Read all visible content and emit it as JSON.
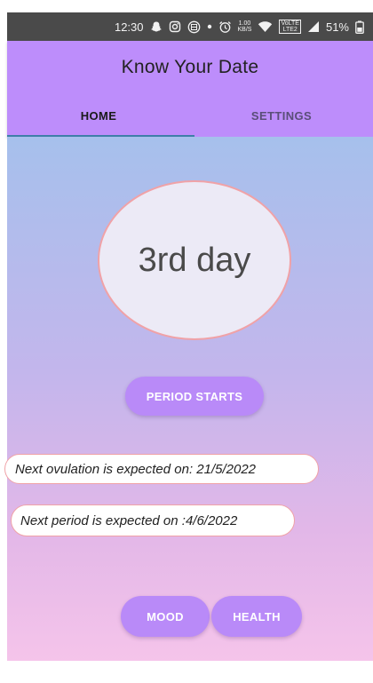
{
  "status_bar": {
    "time": "12:30",
    "speed_value": "1.00",
    "speed_unit": "KB/S",
    "volte_top": "VoLTE",
    "volte_bottom": "LTE2",
    "battery": "51%",
    "icons": [
      "snapchat-icon",
      "instagram-icon",
      "app-icon",
      "dot-icon",
      "alarm-icon",
      "wifi-icon",
      "signal-icon",
      "battery-icon"
    ]
  },
  "app_bar": {
    "title": "Know Your Date",
    "tabs": [
      {
        "label": "HOME",
        "active": true
      },
      {
        "label": "SETTINGS",
        "active": false
      }
    ]
  },
  "main": {
    "day_counter": "3rd day",
    "period_button": "PERIOD STARTS",
    "ovulation_text": "Next ovulation is expected on: 21/5/2022",
    "next_period_text": "Next period is expected on :4/6/2022",
    "mood_button": "MOOD",
    "health_button": "HEALTH"
  },
  "colors": {
    "app_bar": "#bd8dfb",
    "button": "#b98af8",
    "circle_border": "#f0a2a7",
    "gradient_top": "#a6c0ec",
    "gradient_bottom": "#f5c4ea",
    "tab_indicator": "#3e7ea8"
  }
}
